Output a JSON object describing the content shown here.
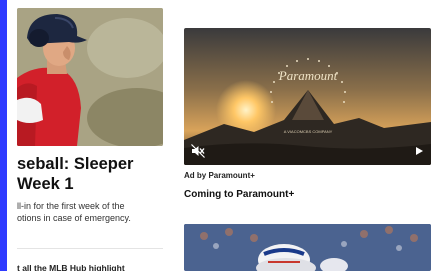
{
  "left_article": {
    "headline_line1": "seball: Sleeper",
    "headline_line2": "Week 1",
    "summary_line1": "ll-in for the first week of the",
    "summary_line2": "otions in case of emergency.",
    "next_article_title": "t all the MLB Hub highlight"
  },
  "ad": {
    "sponsor_label": "Ad by Paramount+",
    "title": "Coming to Paramount+",
    "video_logo_text": "Paramount",
    "video_tagline": "A VIACOMCBS COMPANY",
    "mute_icon": "muted-speaker-icon",
    "play_icon": "play-icon"
  },
  "colors": {
    "accent": "#2f3bff"
  }
}
